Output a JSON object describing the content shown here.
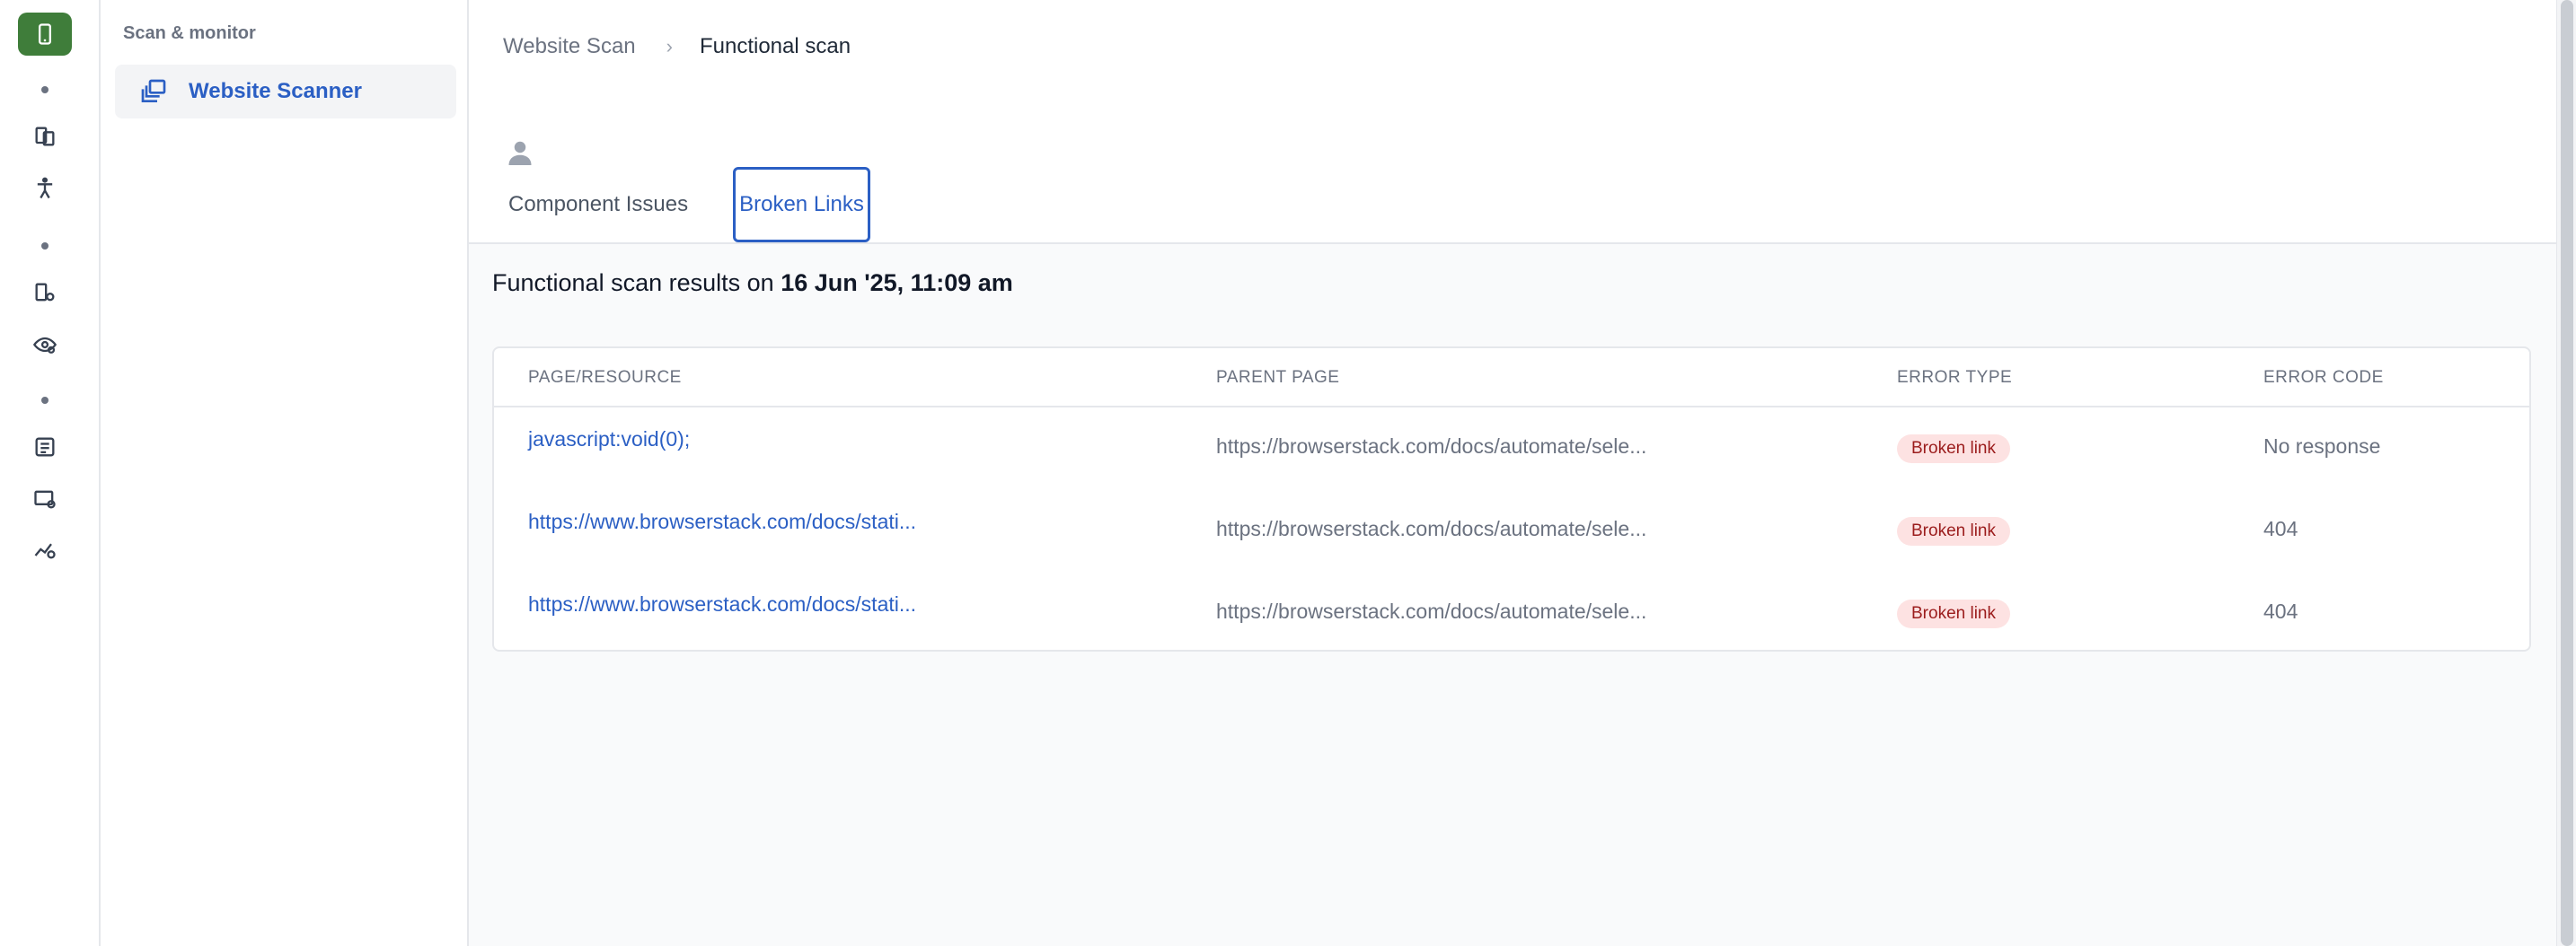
{
  "rail": {
    "items": [
      {
        "icon": "mobile-icon",
        "active": true
      },
      {
        "icon": "pages-icon"
      },
      {
        "icon": "accessibility-icon"
      },
      {
        "icon": "page-settings-icon"
      },
      {
        "icon": "eye-settings-icon"
      },
      {
        "icon": "checklist-icon"
      },
      {
        "icon": "screen-settings-icon"
      },
      {
        "icon": "chart-settings-icon"
      }
    ],
    "accent": "#3f7d3a"
  },
  "sidebar": {
    "heading": "Scan & monitor",
    "items": [
      {
        "label": "Website Scanner",
        "active": true
      }
    ]
  },
  "breadcrumb": {
    "parent": "Website Scan",
    "current": "Functional scan"
  },
  "tabs": [
    {
      "label": "Component Issues",
      "active": false
    },
    {
      "label": "Broken Links",
      "active": true
    }
  ],
  "results": {
    "prefix": "Functional scan results on",
    "date": "16 Jun '25, 11:09 am"
  },
  "table": {
    "headers": [
      "PAGE/RESOURCE",
      "PARENT PAGE",
      "ERROR TYPE",
      "ERROR CODE"
    ],
    "rows": [
      {
        "resource": "javascript:void(0);",
        "parent": "https://browserstack.com/docs/automate/sele...",
        "error_type": "Broken link",
        "error_code": "No response"
      },
      {
        "resource": "https://www.browserstack.com/docs/stati...",
        "parent": "https://browserstack.com/docs/automate/sele...",
        "error_type": "Broken link",
        "error_code": "404"
      },
      {
        "resource": "https://www.browserstack.com/docs/stati...",
        "parent": "https://browserstack.com/docs/automate/sele...",
        "error_type": "Broken link",
        "error_code": "404"
      }
    ]
  },
  "colors": {
    "link": "#2b5fc4",
    "badge_bg": "#fde2e2",
    "badge_text": "#9b1c1c"
  }
}
